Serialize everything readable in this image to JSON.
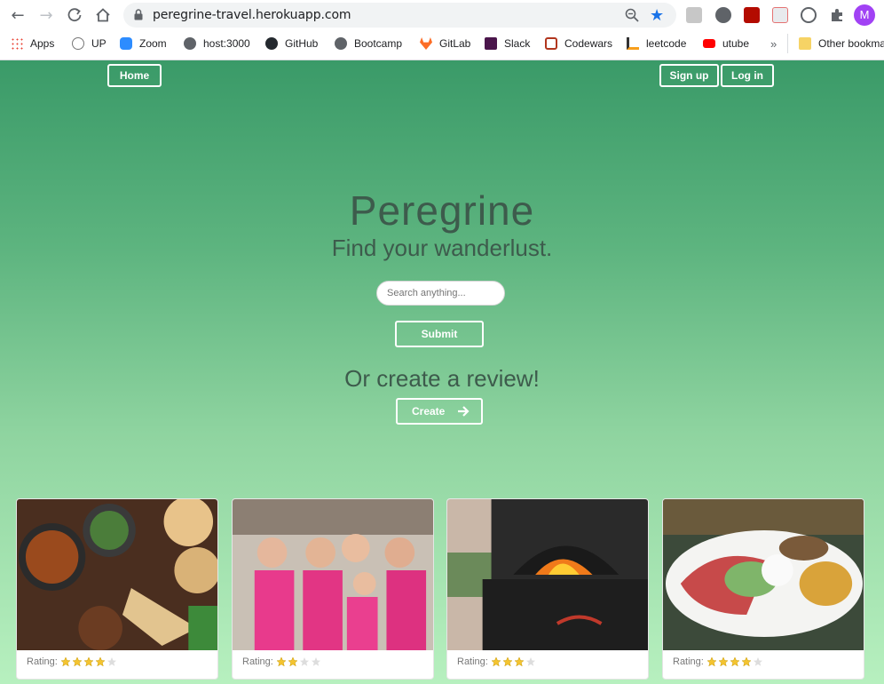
{
  "browser": {
    "url": "peregrine-travel.herokuapp.com",
    "avatar_letter": "M",
    "bookmarks": [
      {
        "label": "Apps",
        "icon": "apps-grid-icon"
      },
      {
        "label": "UP",
        "icon": "up-icon"
      },
      {
        "label": "Zoom",
        "icon": "zoom-icon"
      },
      {
        "label": "host:3000",
        "icon": "globe-icon"
      },
      {
        "label": "GitHub",
        "icon": "github-icon"
      },
      {
        "label": "Bootcamp",
        "icon": "globe-icon"
      },
      {
        "label": "GitLab",
        "icon": "gitlab-icon"
      },
      {
        "label": "Slack",
        "icon": "slack-icon"
      },
      {
        "label": "Codewars",
        "icon": "codewars-icon"
      },
      {
        "label": "leetcode",
        "icon": "leetcode-icon"
      },
      {
        "label": "utube",
        "icon": "youtube-icon"
      }
    ],
    "more_bookmarks": "»",
    "other_bookmarks": "Other bookmarks"
  },
  "nav": {
    "home": "Home",
    "signup": "Sign up",
    "login": "Log in"
  },
  "hero": {
    "title": "Peregrine",
    "subtitle": "Find your wanderlust.",
    "search_placeholder": "Search anything...",
    "submit": "Submit",
    "create_heading": "Or create a review!",
    "create_button": "Create"
  },
  "cards": [
    {
      "rating_label": "Rating:",
      "rating": 4,
      "photo": "indian-food-spread"
    },
    {
      "rating_label": "Rating:",
      "rating": 2,
      "photo": "women-in-pink-aprons"
    },
    {
      "rating_label": "Rating:",
      "rating": 3,
      "photo": "pizza-oven"
    },
    {
      "rating_label": "Rating:",
      "rating": 4,
      "photo": "mexican-plate"
    }
  ],
  "colors": {
    "star_filled": "#f4c430",
    "star_empty": "#dddddd",
    "brand_green": "#3a9a68"
  }
}
